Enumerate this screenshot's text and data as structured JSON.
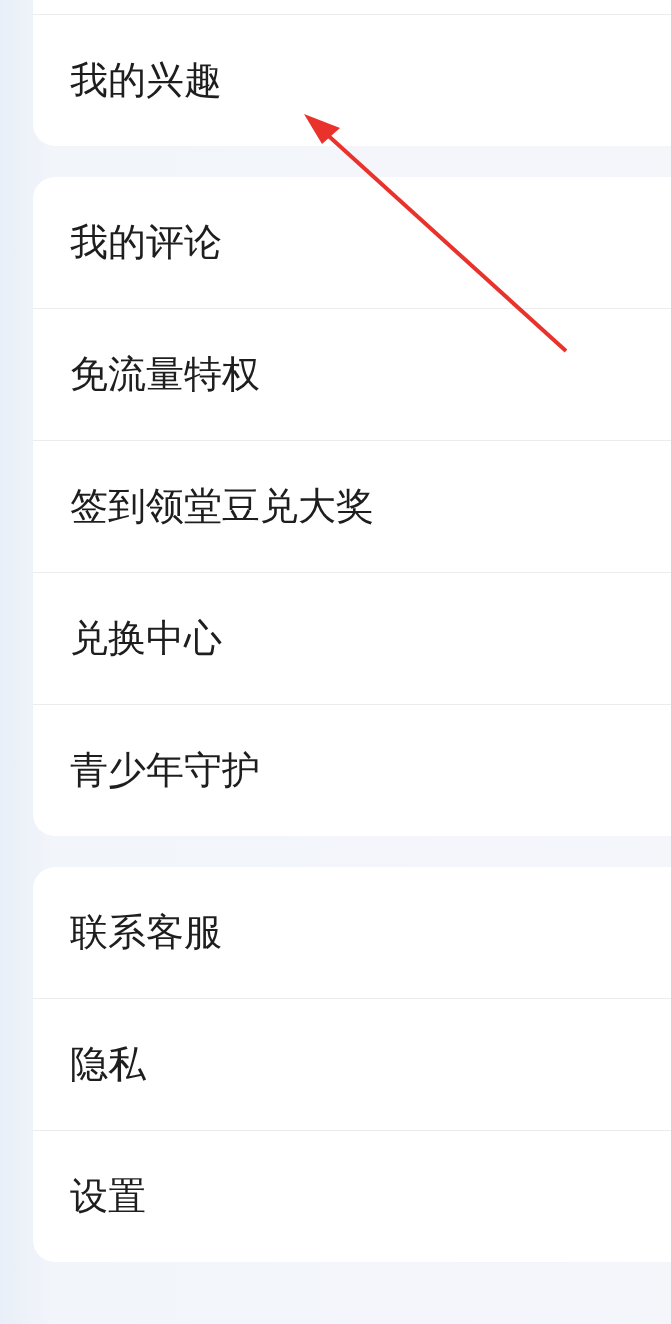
{
  "groups": [
    {
      "cut_top": true,
      "items": [
        {
          "label": "我的兴趣"
        }
      ]
    },
    {
      "cut_top": false,
      "items": [
        {
          "label": "我的评论"
        },
        {
          "label": "免流量特权"
        },
        {
          "label": "签到领堂豆兑大奖"
        },
        {
          "label": "兑换中心"
        },
        {
          "label": "青少年守护"
        }
      ]
    },
    {
      "cut_top": false,
      "items": [
        {
          "label": "联系客服"
        },
        {
          "label": "隐私"
        },
        {
          "label": "设置"
        }
      ]
    }
  ]
}
